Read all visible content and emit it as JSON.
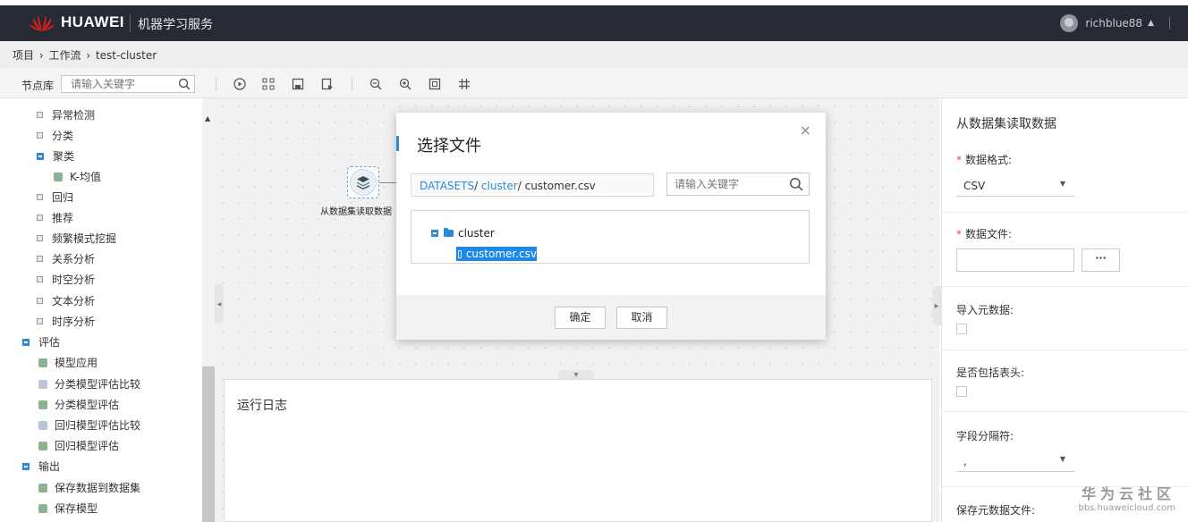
{
  "header": {
    "brand": "HUAWEI",
    "service": "机器学习服务",
    "username": "richblue88",
    "brand_color": "#e31d1c"
  },
  "breadcrumb": {
    "items": [
      "项目",
      "工作流",
      "test-cluster"
    ],
    "separator": "›"
  },
  "toolbar": {
    "node_library_label": "节点库",
    "search_placeholder": "请输入关键字",
    "icons": [
      "run-icon",
      "layout-icon",
      "save-icon",
      "save-as-icon",
      "zoom-out-icon",
      "zoom-in-icon",
      "fit-icon",
      "grid-icon"
    ]
  },
  "tree": {
    "items": [
      {
        "label": "异常检测",
        "type": "collapsed"
      },
      {
        "label": "分类",
        "type": "collapsed"
      },
      {
        "label": "聚类",
        "type": "expanded"
      },
      {
        "label": "K-均值",
        "type": "leaf"
      },
      {
        "label": "回归",
        "type": "collapsed"
      },
      {
        "label": "推荐",
        "type": "collapsed"
      },
      {
        "label": "频繁模式挖掘",
        "type": "collapsed"
      },
      {
        "label": "关系分析",
        "type": "collapsed"
      },
      {
        "label": "时空分析",
        "type": "collapsed"
      },
      {
        "label": "文本分析",
        "type": "collapsed"
      },
      {
        "label": "时序分析",
        "type": "collapsed"
      },
      {
        "label": "评估",
        "type": "expanded-root"
      },
      {
        "label": "模型应用",
        "type": "leaf"
      },
      {
        "label": "分类模型评估比较",
        "type": "leaf"
      },
      {
        "label": "分类模型评估",
        "type": "leaf"
      },
      {
        "label": "回归模型评估比较",
        "type": "leaf"
      },
      {
        "label": "回归模型评估",
        "type": "leaf"
      },
      {
        "label": "输出",
        "type": "expanded-root"
      },
      {
        "label": "保存数据到数据集",
        "type": "leaf"
      },
      {
        "label": "保存模型",
        "type": "leaf"
      }
    ]
  },
  "canvas": {
    "node_label": "从数据集读取数据",
    "log_title": "运行日志"
  },
  "right_panel": {
    "title": "从数据集读取数据",
    "data_format_label": "数据格式:",
    "data_format_value": "CSV",
    "data_file_label": "数据文件:",
    "browse_label": "···",
    "import_meta_label": "导入元数据:",
    "has_header_label": "是否包括表头:",
    "delimiter_label": "字段分隔符:",
    "delimiter_value": ",",
    "save_meta_label": "保存元数据文件:"
  },
  "watermark": {
    "line1": "华为云社区",
    "line2": "bbs.huaweicloud.com"
  },
  "modal": {
    "title": "选择文件",
    "path_root": "DATASETS",
    "path_folder": "cluster",
    "path_file": "customer.csv",
    "search_placeholder": "请输入关键字",
    "folder_name": "cluster",
    "file_name": "customer.csv",
    "confirm_label": "确定",
    "cancel_label": "取消",
    "accent_color": "#2a8ad8"
  }
}
